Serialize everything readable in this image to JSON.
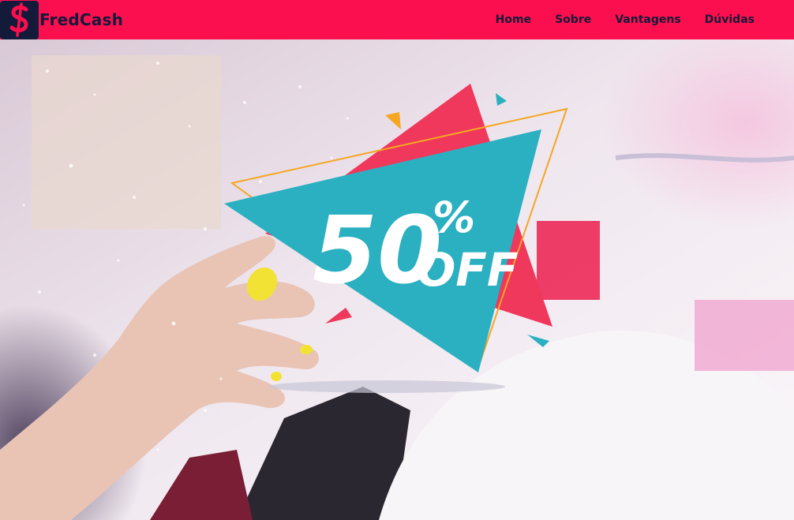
{
  "brand": {
    "name": "FredCash",
    "logo_icon": "dollar-sign-icon"
  },
  "nav": {
    "items": [
      {
        "label": "Home"
      },
      {
        "label": "Sobre"
      },
      {
        "label": "Vantagens"
      },
      {
        "label": "Dúvidas"
      }
    ]
  },
  "hero": {
    "discount_value": "50",
    "discount_percent": "%",
    "discount_off": "OFF"
  },
  "colors": {
    "navbar": "#fc0f4e",
    "dark": "#141a3a",
    "teal": "#2bb0c1",
    "pink": "#f0375c",
    "orange": "#f5a623"
  }
}
